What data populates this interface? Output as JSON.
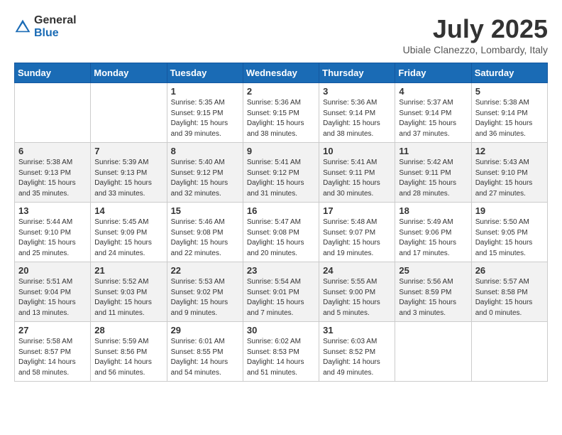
{
  "header": {
    "logo_general": "General",
    "logo_blue": "Blue",
    "month_title": "July 2025",
    "location": "Ubiale Clanezzo, Lombardy, Italy"
  },
  "calendar": {
    "days_of_week": [
      "Sunday",
      "Monday",
      "Tuesday",
      "Wednesday",
      "Thursday",
      "Friday",
      "Saturday"
    ],
    "weeks": [
      [
        {
          "day": "",
          "detail": ""
        },
        {
          "day": "",
          "detail": ""
        },
        {
          "day": "1",
          "detail": "Sunrise: 5:35 AM\nSunset: 9:15 PM\nDaylight: 15 hours\nand 39 minutes."
        },
        {
          "day": "2",
          "detail": "Sunrise: 5:36 AM\nSunset: 9:15 PM\nDaylight: 15 hours\nand 38 minutes."
        },
        {
          "day": "3",
          "detail": "Sunrise: 5:36 AM\nSunset: 9:14 PM\nDaylight: 15 hours\nand 38 minutes."
        },
        {
          "day": "4",
          "detail": "Sunrise: 5:37 AM\nSunset: 9:14 PM\nDaylight: 15 hours\nand 37 minutes."
        },
        {
          "day": "5",
          "detail": "Sunrise: 5:38 AM\nSunset: 9:14 PM\nDaylight: 15 hours\nand 36 minutes."
        }
      ],
      [
        {
          "day": "6",
          "detail": "Sunrise: 5:38 AM\nSunset: 9:13 PM\nDaylight: 15 hours\nand 35 minutes."
        },
        {
          "day": "7",
          "detail": "Sunrise: 5:39 AM\nSunset: 9:13 PM\nDaylight: 15 hours\nand 33 minutes."
        },
        {
          "day": "8",
          "detail": "Sunrise: 5:40 AM\nSunset: 9:12 PM\nDaylight: 15 hours\nand 32 minutes."
        },
        {
          "day": "9",
          "detail": "Sunrise: 5:41 AM\nSunset: 9:12 PM\nDaylight: 15 hours\nand 31 minutes."
        },
        {
          "day": "10",
          "detail": "Sunrise: 5:41 AM\nSunset: 9:11 PM\nDaylight: 15 hours\nand 30 minutes."
        },
        {
          "day": "11",
          "detail": "Sunrise: 5:42 AM\nSunset: 9:11 PM\nDaylight: 15 hours\nand 28 minutes."
        },
        {
          "day": "12",
          "detail": "Sunrise: 5:43 AM\nSunset: 9:10 PM\nDaylight: 15 hours\nand 27 minutes."
        }
      ],
      [
        {
          "day": "13",
          "detail": "Sunrise: 5:44 AM\nSunset: 9:10 PM\nDaylight: 15 hours\nand 25 minutes."
        },
        {
          "day": "14",
          "detail": "Sunrise: 5:45 AM\nSunset: 9:09 PM\nDaylight: 15 hours\nand 24 minutes."
        },
        {
          "day": "15",
          "detail": "Sunrise: 5:46 AM\nSunset: 9:08 PM\nDaylight: 15 hours\nand 22 minutes."
        },
        {
          "day": "16",
          "detail": "Sunrise: 5:47 AM\nSunset: 9:08 PM\nDaylight: 15 hours\nand 20 minutes."
        },
        {
          "day": "17",
          "detail": "Sunrise: 5:48 AM\nSunset: 9:07 PM\nDaylight: 15 hours\nand 19 minutes."
        },
        {
          "day": "18",
          "detail": "Sunrise: 5:49 AM\nSunset: 9:06 PM\nDaylight: 15 hours\nand 17 minutes."
        },
        {
          "day": "19",
          "detail": "Sunrise: 5:50 AM\nSunset: 9:05 PM\nDaylight: 15 hours\nand 15 minutes."
        }
      ],
      [
        {
          "day": "20",
          "detail": "Sunrise: 5:51 AM\nSunset: 9:04 PM\nDaylight: 15 hours\nand 13 minutes."
        },
        {
          "day": "21",
          "detail": "Sunrise: 5:52 AM\nSunset: 9:03 PM\nDaylight: 15 hours\nand 11 minutes."
        },
        {
          "day": "22",
          "detail": "Sunrise: 5:53 AM\nSunset: 9:02 PM\nDaylight: 15 hours\nand 9 minutes."
        },
        {
          "day": "23",
          "detail": "Sunrise: 5:54 AM\nSunset: 9:01 PM\nDaylight: 15 hours\nand 7 minutes."
        },
        {
          "day": "24",
          "detail": "Sunrise: 5:55 AM\nSunset: 9:00 PM\nDaylight: 15 hours\nand 5 minutes."
        },
        {
          "day": "25",
          "detail": "Sunrise: 5:56 AM\nSunset: 8:59 PM\nDaylight: 15 hours\nand 3 minutes."
        },
        {
          "day": "26",
          "detail": "Sunrise: 5:57 AM\nSunset: 8:58 PM\nDaylight: 15 hours\nand 0 minutes."
        }
      ],
      [
        {
          "day": "27",
          "detail": "Sunrise: 5:58 AM\nSunset: 8:57 PM\nDaylight: 14 hours\nand 58 minutes."
        },
        {
          "day": "28",
          "detail": "Sunrise: 5:59 AM\nSunset: 8:56 PM\nDaylight: 14 hours\nand 56 minutes."
        },
        {
          "day": "29",
          "detail": "Sunrise: 6:01 AM\nSunset: 8:55 PM\nDaylight: 14 hours\nand 54 minutes."
        },
        {
          "day": "30",
          "detail": "Sunrise: 6:02 AM\nSunset: 8:53 PM\nDaylight: 14 hours\nand 51 minutes."
        },
        {
          "day": "31",
          "detail": "Sunrise: 6:03 AM\nSunset: 8:52 PM\nDaylight: 14 hours\nand 49 minutes."
        },
        {
          "day": "",
          "detail": ""
        },
        {
          "day": "",
          "detail": ""
        }
      ]
    ]
  }
}
